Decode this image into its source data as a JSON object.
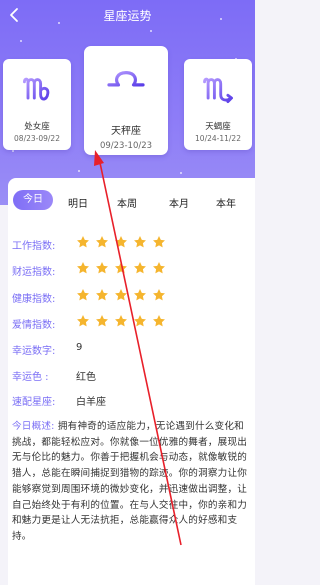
{
  "header": {
    "title": "星座运势",
    "back_icon": "chevron-left-icon"
  },
  "signs": [
    {
      "name": "处女座",
      "dates": "08/23-09/22",
      "icon": "virgo-icon"
    },
    {
      "name": "天秤座",
      "dates": "09/23-10/23",
      "icon": "libra-icon",
      "selected": true
    },
    {
      "name": "天蝎座",
      "dates": "10/24-11/22",
      "icon": "scorpio-icon"
    }
  ],
  "tabs": [
    "今日",
    "明日",
    "本周",
    "本月",
    "本年"
  ],
  "active_tab": "今日",
  "fortune": {
    "work": {
      "label": "工作指数:",
      "stars": 5
    },
    "wealth": {
      "label": "财运指数:",
      "stars": 5
    },
    "health": {
      "label": "健康指数:",
      "stars": 5
    },
    "love": {
      "label": "爱情指数:",
      "stars": 5
    },
    "lucky_number": {
      "label": "幸运数字:",
      "value": "9"
    },
    "lucky_color": {
      "label": "幸运色  :",
      "value": "红色"
    },
    "match_sign": {
      "label": "速配星座:",
      "value": "白羊座"
    },
    "summary": {
      "label": "今日概述:",
      "text": "拥有神奇的适应能力，无论遇到什么变化和挑战，都能轻松应对。你就像一位优雅的舞者，展现出无与伦比的魅力。你善于把握机会与动态，就像敏锐的猎人，总能在瞬间捕捉到猎物的踪迹。你的洞察力让你能够察觉到周围环境的微妙变化，并迅速做出调整，让自己始终处于有利的位置。在与人交往中，你的亲和力和魅力更是让人无法抗拒，总能赢得众人的好感和支持。"
    }
  },
  "colors": {
    "accent": "#7d6cf6",
    "star": "#f5b52e"
  }
}
